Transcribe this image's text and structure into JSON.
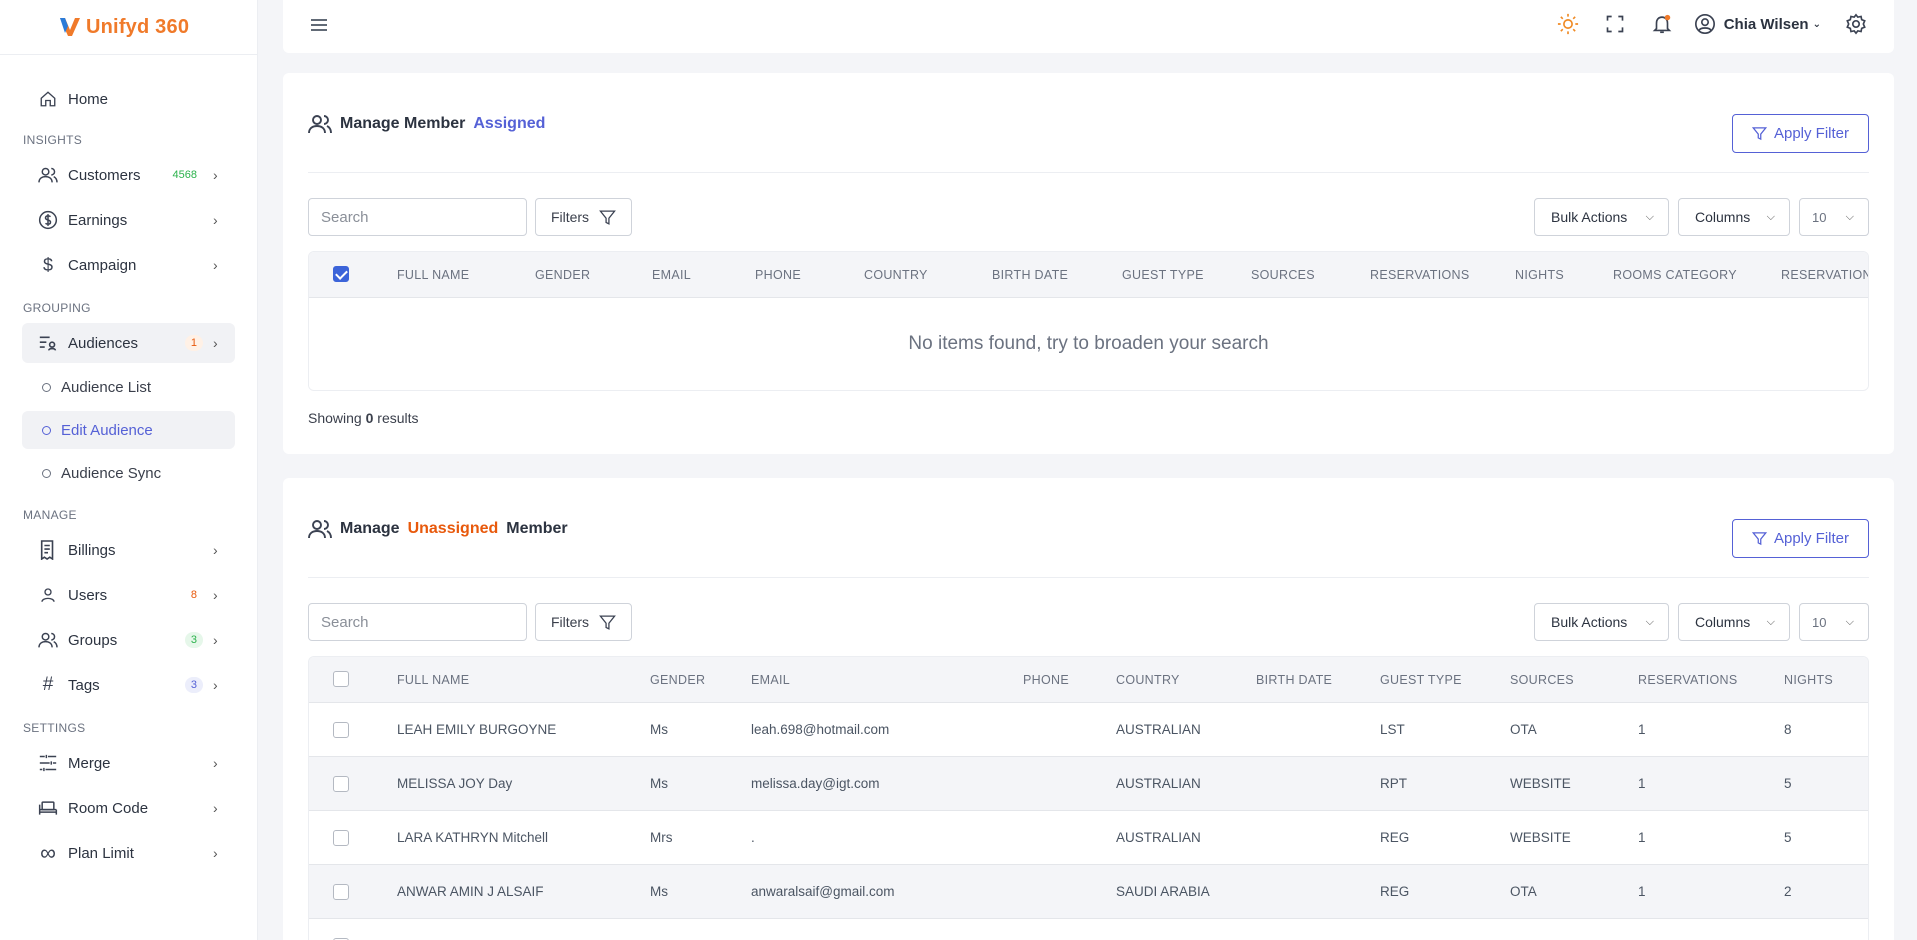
{
  "app": {
    "logo_text": "Unifyd 360"
  },
  "sidebar": {
    "home": "Home",
    "sections": {
      "insights": "INSIGHTS",
      "grouping": "GROUPING",
      "manage": "MANAGE",
      "settings": "SETTINGS"
    },
    "customers": {
      "label": "Customers",
      "badge": "4568"
    },
    "earnings": {
      "label": "Earnings"
    },
    "campaign": {
      "label": "Campaign"
    },
    "audiences": {
      "label": "Audiences",
      "badge": "1"
    },
    "audience_list": "Audience List",
    "edit_audience": "Edit Audience",
    "audience_sync": "Audience Sync",
    "billings": {
      "label": "Billings"
    },
    "users": {
      "label": "Users",
      "badge": "8"
    },
    "groups": {
      "label": "Groups",
      "badge": "3"
    },
    "tags": {
      "label": "Tags",
      "badge": "3"
    },
    "merge": {
      "label": "Merge"
    },
    "room_code": {
      "label": "Room Code"
    },
    "plan_limit": {
      "label": "Plan Limit"
    }
  },
  "topbar": {
    "user_name": "Chia Wilsen"
  },
  "assigned": {
    "title_a": "Manage Member",
    "title_b": "Assigned",
    "apply": "Apply Filter",
    "search_placeholder": "Search",
    "filters": "Filters",
    "bulk": "Bulk Actions",
    "columns": "Columns",
    "per_page": "10",
    "headers": [
      "FULL NAME",
      "GENDER",
      "EMAIL",
      "PHONE",
      "COUNTRY",
      "BIRTH DATE",
      "GUEST TYPE",
      "SOURCES",
      "RESERVATIONS",
      "NIGHTS",
      "ROOMS CATEGORY",
      "RESERVATION"
    ],
    "empty": "No items found, try to broaden your search",
    "showing_prefix": "Showing",
    "showing_count": "0",
    "showing_suffix": "results"
  },
  "unassigned": {
    "title_a": "Manage",
    "title_b": "Unassigned",
    "title_c": "Member",
    "apply": "Apply Filter",
    "search_placeholder": "Search",
    "filters": "Filters",
    "bulk": "Bulk Actions",
    "columns": "Columns",
    "per_page": "10",
    "headers": [
      "FULL NAME",
      "GENDER",
      "EMAIL",
      "PHONE",
      "COUNTRY",
      "BIRTH DATE",
      "GUEST TYPE",
      "SOURCES",
      "RESERVATIONS",
      "NIGHTS"
    ],
    "rows": [
      {
        "name": "LEAH EMILY BURGOYNE",
        "gender": "Ms",
        "email": "leah.698@hotmail.com",
        "country": "AUSTRALIAN",
        "guest_type": "LST",
        "source": "OTA",
        "reservations": "1",
        "nights": "8"
      },
      {
        "name": "MELISSA JOY Day",
        "gender": "Ms",
        "email": "melissa.day@igt.com",
        "country": "AUSTRALIAN",
        "guest_type": "RPT",
        "source": "WEBSITE",
        "reservations": "1",
        "nights": "5"
      },
      {
        "name": "LARA KATHRYN Mitchell",
        "gender": "Mrs",
        "email": ".",
        "country": "AUSTRALIAN",
        "guest_type": "REG",
        "source": "WEBSITE",
        "reservations": "1",
        "nights": "5"
      },
      {
        "name": "ANWAR AMIN J ALSAIF",
        "gender": "Ms",
        "email": "anwaralsaif@gmail.com",
        "country": "SAUDI ARABIA",
        "guest_type": "REG",
        "source": "OTA",
        "reservations": "1",
        "nights": "2"
      }
    ]
  }
}
